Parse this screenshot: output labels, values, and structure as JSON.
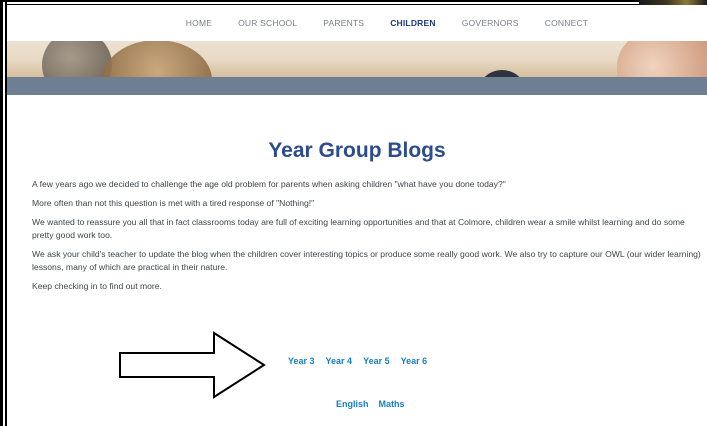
{
  "nav": {
    "items": [
      {
        "label": "HOME"
      },
      {
        "label": "OUR SCHOOL"
      },
      {
        "label": "PARENTS"
      },
      {
        "label": "CHILDREN",
        "active": true
      },
      {
        "label": "GOVERNORS"
      },
      {
        "label": "CONNECT"
      }
    ]
  },
  "page": {
    "title": "Year Group Blogs",
    "paragraphs": [
      "A few years ago we decided to challenge the age old problem for parents when asking children \"what have you done today?\"",
      "More often than not this question is met with a tired response of \"Nothing!\"",
      "We wanted to reassure you all that in fact classrooms today are full of exciting learning opportunities and that at Colmore, children wear a smile whilst learning and do some pretty good work too.",
      "We ask your child's teacher to update the blog when the children cover interesting topics or produce some really good work. We also try to capture our OWL (our wider learning) lessons, many of which are practical in their nature.",
      "Keep checking in to find out more."
    ],
    "year_links": [
      "Year 3",
      "Year 4",
      "Year 5",
      "Year 6"
    ],
    "subject_links": [
      "English",
      "Maths"
    ]
  },
  "colors": {
    "title": "#2c4c8c",
    "link": "#1a7fc0",
    "nav_active": "#1e3a7a",
    "nav": "#7a7f86"
  }
}
